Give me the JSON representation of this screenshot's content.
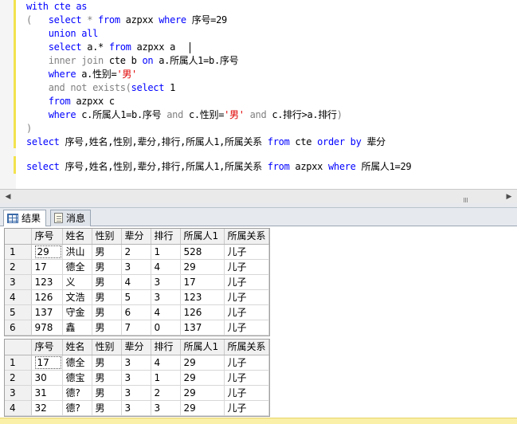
{
  "editor": {
    "lines": [
      [
        {
          "t": "with cte as",
          "c": "kw"
        }
      ],
      [
        {
          "t": "(   ",
          "c": "gray"
        },
        {
          "t": "select",
          "c": "kw"
        },
        {
          "t": " * ",
          "c": "gray"
        },
        {
          "t": "from",
          "c": "kw"
        },
        {
          "t": " azpxx ",
          "c": "txt"
        },
        {
          "t": "where",
          "c": "kw"
        },
        {
          "t": " 序号=29",
          "c": "txt"
        }
      ],
      [
        {
          "t": "    ",
          "c": "txt"
        },
        {
          "t": "union all",
          "c": "kw"
        }
      ],
      [
        {
          "t": "    ",
          "c": "txt"
        },
        {
          "t": "select",
          "c": "kw"
        },
        {
          "t": " a.* ",
          "c": "txt"
        },
        {
          "t": "from",
          "c": "kw"
        },
        {
          "t": " azpxx a",
          "c": "txt"
        }
      ],
      [
        {
          "t": "    ",
          "c": "txt"
        },
        {
          "t": "inner join",
          "c": "gray"
        },
        {
          "t": " cte b ",
          "c": "txt"
        },
        {
          "t": "on",
          "c": "kw"
        },
        {
          "t": " a.所属人1=b.序号",
          "c": "txt"
        }
      ],
      [
        {
          "t": "    ",
          "c": "txt"
        },
        {
          "t": "where",
          "c": "kw"
        },
        {
          "t": " a.性别=",
          "c": "txt"
        },
        {
          "t": "'男'",
          "c": "str"
        }
      ],
      [
        {
          "t": "    ",
          "c": "txt"
        },
        {
          "t": "and not exists",
          "c": "gray"
        },
        {
          "t": "(",
          "c": "gray"
        },
        {
          "t": "select",
          "c": "kw"
        },
        {
          "t": " 1",
          "c": "txt"
        }
      ],
      [
        {
          "t": "    ",
          "c": "txt"
        },
        {
          "t": "from",
          "c": "kw"
        },
        {
          "t": " azpxx c",
          "c": "txt"
        }
      ],
      [
        {
          "t": "    ",
          "c": "txt"
        },
        {
          "t": "where",
          "c": "kw"
        },
        {
          "t": " c.所属人1=b.序号 ",
          "c": "txt"
        },
        {
          "t": "and",
          "c": "gray"
        },
        {
          "t": " c.性别=",
          "c": "txt"
        },
        {
          "t": "'男'",
          "c": "str"
        },
        {
          "t": " ",
          "c": "txt"
        },
        {
          "t": "and",
          "c": "gray"
        },
        {
          "t": " c.排行>a.排行",
          "c": "txt"
        },
        {
          "t": ")",
          "c": "gray"
        }
      ],
      [
        {
          "t": ")",
          "c": "gray"
        }
      ],
      [
        {
          "t": "select",
          "c": "kw"
        },
        {
          "t": " 序号,姓名,性别,辈分,排行,所属人1,所属关系 ",
          "c": "txt"
        },
        {
          "t": "from",
          "c": "kw"
        },
        {
          "t": " cte ",
          "c": "txt"
        },
        {
          "t": "order by",
          "c": "kw"
        },
        {
          "t": " 辈分",
          "c": "txt"
        }
      ],
      [],
      [
        {
          "t": "select",
          "c": "kw"
        },
        {
          "t": " 序号,姓名,性别,辈分,排行,所属人1,所属关系 ",
          "c": "txt"
        },
        {
          "t": "from",
          "c": "kw"
        },
        {
          "t": " azpxx ",
          "c": "txt"
        },
        {
          "t": "where",
          "c": "kw"
        },
        {
          "t": " 所属人1=29",
          "c": "txt"
        }
      ]
    ]
  },
  "scrollbar": {
    "left_arrow": "◀",
    "right_arrow": "▶"
  },
  "tabs": [
    {
      "label": "结果",
      "icon": "results-grid-icon",
      "active": true
    },
    {
      "label": "消息",
      "icon": "messages-icon",
      "active": false
    }
  ],
  "results": {
    "columns": [
      "序号",
      "姓名",
      "性别",
      "辈分",
      "排行",
      "所属人1",
      "所属关系"
    ],
    "grid1": [
      [
        "1",
        "29",
        "洪山",
        "男",
        "2",
        "1",
        "528",
        "儿子"
      ],
      [
        "2",
        "17",
        "德全",
        "男",
        "3",
        "4",
        "29",
        "儿子"
      ],
      [
        "3",
        "123",
        "义",
        "男",
        "4",
        "3",
        "17",
        "儿子"
      ],
      [
        "4",
        "126",
        "文浩",
        "男",
        "5",
        "3",
        "123",
        "儿子"
      ],
      [
        "5",
        "137",
        "守金",
        "男",
        "6",
        "4",
        "126",
        "儿子"
      ],
      [
        "6",
        "978",
        "鑫",
        "男",
        "7",
        "0",
        "137",
        "儿子"
      ]
    ],
    "grid2": [
      [
        "1",
        "17",
        "德全",
        "男",
        "3",
        "4",
        "29",
        "儿子"
      ],
      [
        "2",
        "30",
        "德宝",
        "男",
        "3",
        "1",
        "29",
        "儿子"
      ],
      [
        "3",
        "31",
        "德?",
        "男",
        "3",
        "2",
        "29",
        "儿子"
      ],
      [
        "4",
        "32",
        "德?",
        "男",
        "3",
        "3",
        "29",
        "儿子"
      ]
    ]
  }
}
